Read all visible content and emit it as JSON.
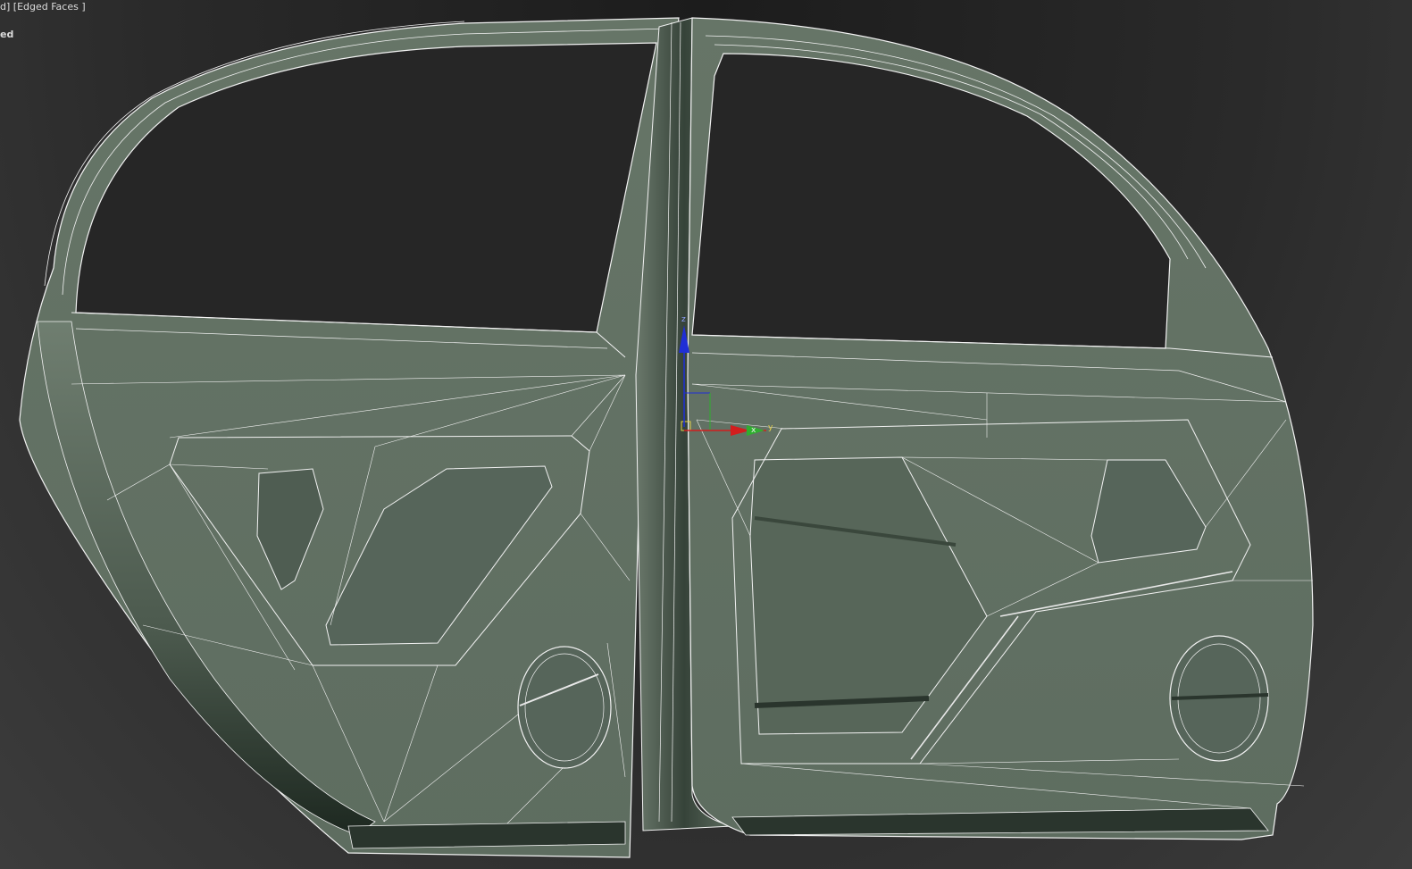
{
  "viewport": {
    "label_prefix": "d]",
    "shading_mode": "[Edged Faces ]",
    "label_line2": "ed"
  },
  "gizmo": {
    "axis_z": "z",
    "axis_y": "y",
    "axis_x": "x",
    "colors": {
      "z": "#1f2fd6",
      "y": "#2fae2f",
      "x": "#d21e1e",
      "gizmo_yellow": "#e6d14a"
    }
  },
  "mesh": {
    "object": "car-door-pair",
    "face_color": "#637264",
    "face_color_dark": "#3d4a40",
    "edge_color": "#f2f2f2"
  }
}
